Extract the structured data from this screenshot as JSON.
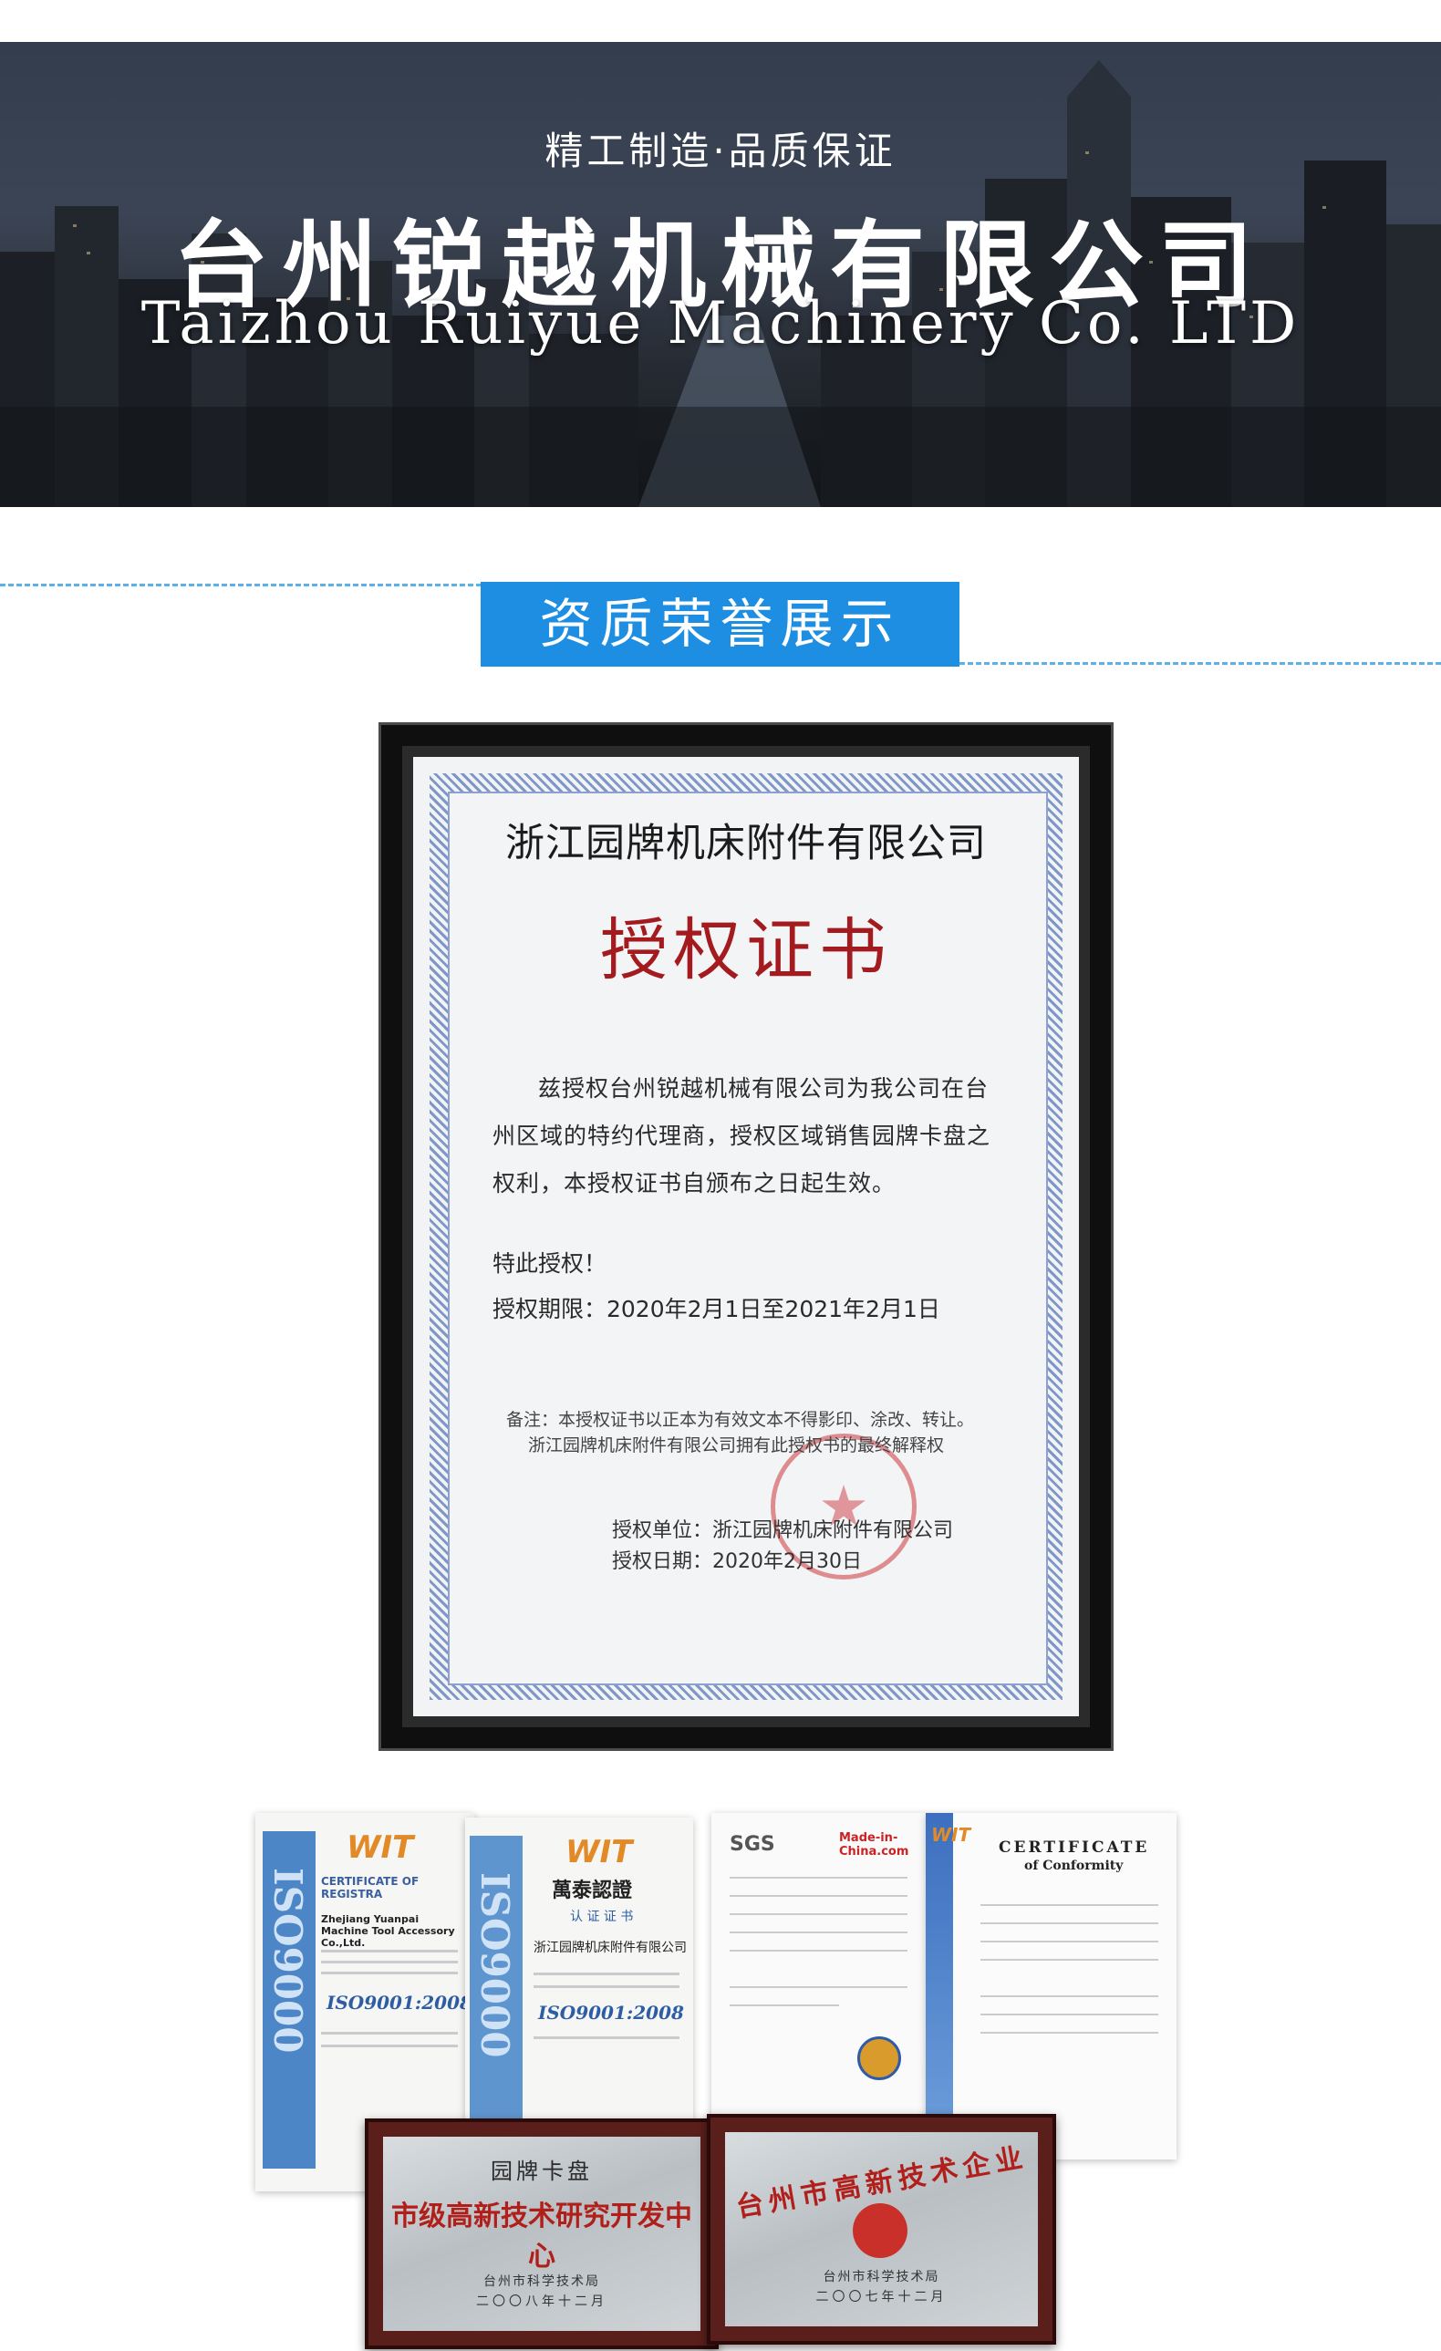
{
  "banner": {
    "slogan": "精工制造·品质保证",
    "company_cn": "台州锐越机械有限公司",
    "company_en": "Taizhou Ruiyue Machinery Co. LTD"
  },
  "section": {
    "title": "资质荣誉展示"
  },
  "certificate": {
    "header": "浙江园牌机床附件有限公司",
    "title": "授权证书",
    "body": "兹授权台州锐越机械有限公司为我公司在台州区域的特约代理商，授权区域销售园牌卡盘之权利，本授权证书自颁布之日起生效。",
    "special": "特此授权！",
    "period": "授权期限：2020年2月1日至2021年2月1日",
    "note1": "备注：本授权证书以正本为有效文本不得影印、涂改、转让。",
    "note2": "浙江园牌机床附件有限公司拥有此授权书的最终解释权",
    "unit": "授权单位：浙江园牌机床附件有限公司",
    "date": "授权日期：2020年2月30日"
  },
  "collage": {
    "iso_cert_1": {
      "brand": "WIT",
      "title": "CERTIFICATE OF REGISTRA",
      "company": "Zhejiang Yuanpai Machine Tool Accessory Co.,Ltd.",
      "standard": "ISO9001:2008",
      "vertical": "ISO9000"
    },
    "iso_cert_2": {
      "brand": "WIT",
      "title": "萬泰認證",
      "subtitle": "认 证 证 书",
      "company": "浙江园牌机床附件有限公司",
      "standard": "ISO9001:2008",
      "vertical": "ISO9000"
    },
    "sgs_doc": {
      "brand": "SGS",
      "partner": "Made-in-China.com"
    },
    "coc_doc": {
      "title": "CERTIFICATE",
      "subtitle": "of Conformity"
    },
    "plaque_1": {
      "line1": "园牌卡盘",
      "line2": "市级高新技术研究开发中心",
      "issuer": "台州市科学技术局",
      "date": "二〇〇八年十二月"
    },
    "plaque_2": {
      "line1": "台州市高新技术企业",
      "issuer": "台州市科学技术局",
      "date": "二〇〇七年十二月"
    }
  },
  "colors": {
    "accent_blue": "#1e8ee3",
    "dash_blue": "#5bb2ea",
    "cert_red": "#a41b1f",
    "plaque_frame": "#5a1f1b"
  }
}
